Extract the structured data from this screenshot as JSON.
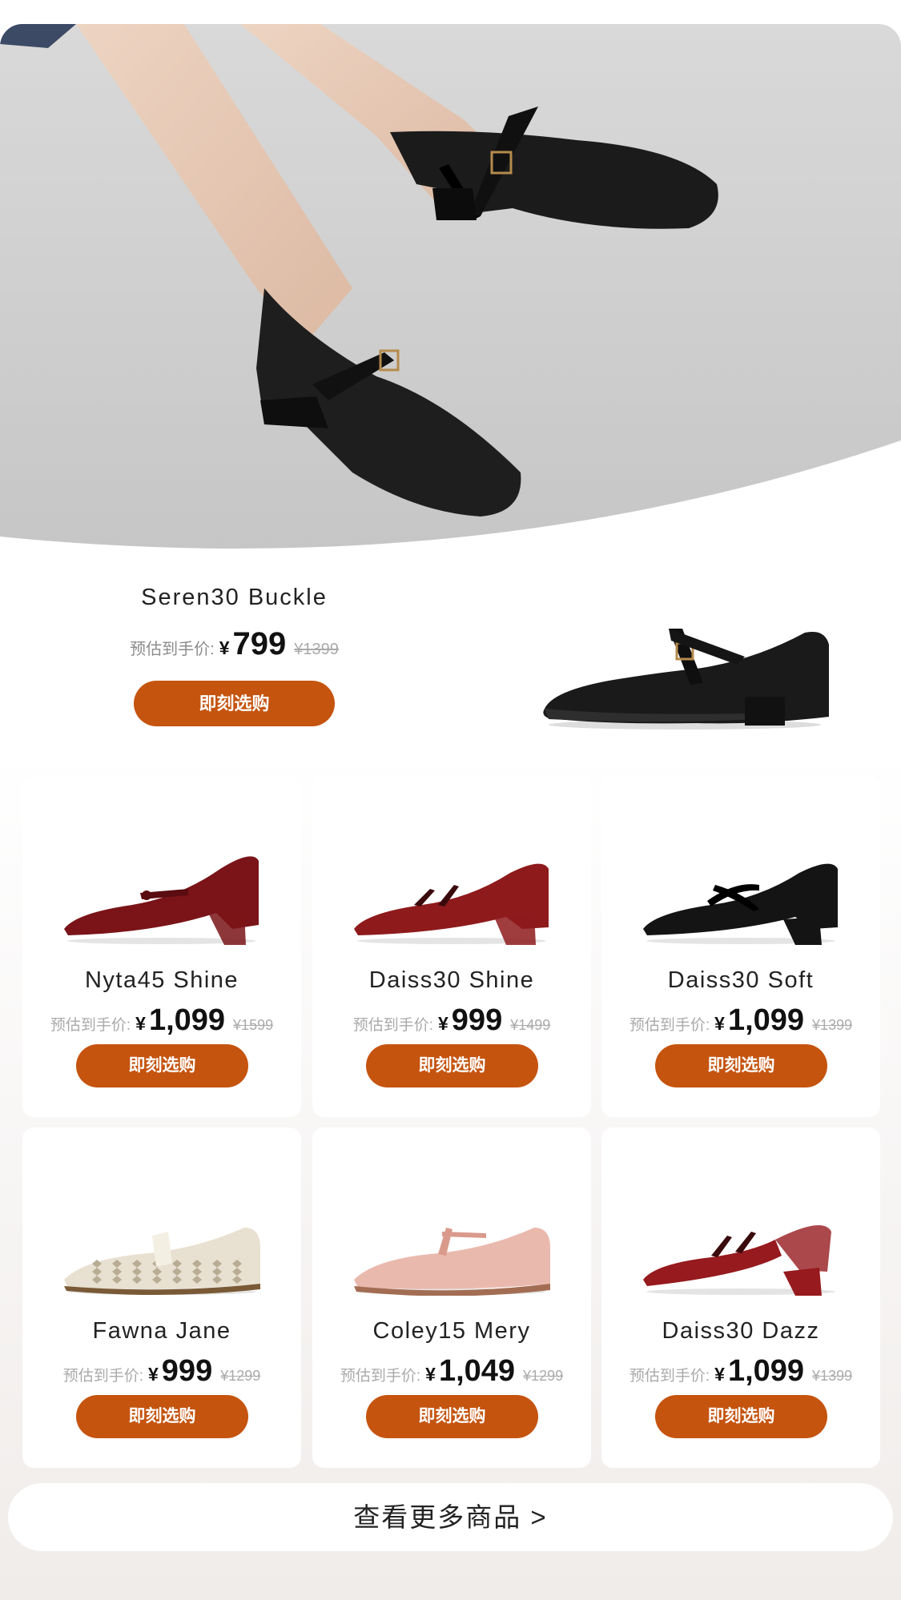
{
  "featured": {
    "name": "Seren30 Buckle",
    "est_label": "预估到手价:",
    "currency": "¥",
    "price": "799",
    "original_price": "¥1399",
    "button_label": "即刻选购"
  },
  "products": [
    {
      "name": "Nyta45 Shine",
      "est_label": "预估到手价:",
      "currency": "¥",
      "price": "1,099",
      "original_price": "¥1599",
      "button_label": "即刻选购",
      "shoe_color": "#7a1418",
      "style": "heel-bow"
    },
    {
      "name": "Daiss30 Shine",
      "est_label": "预估到手价:",
      "currency": "¥",
      "price": "999",
      "original_price": "¥1499",
      "button_label": "即刻选购",
      "shoe_color": "#8e1a1c",
      "style": "double-strap"
    },
    {
      "name": "Daiss30 Soft",
      "est_label": "预估到手价:",
      "currency": "¥",
      "price": "1,099",
      "original_price": "¥1399",
      "button_label": "即刻选购",
      "shoe_color": "#141414",
      "style": "cross-strap"
    },
    {
      "name": "Fawna Jane",
      "est_label": "预估到手价:",
      "currency": "¥",
      "price": "999",
      "original_price": "¥1299",
      "button_label": "即刻选购",
      "shoe_color": "#e8e0d0",
      "style": "woven-flat"
    },
    {
      "name": "Coley15 Mery",
      "est_label": "预估到手价:",
      "currency": "¥",
      "price": "1,049",
      "original_price": "¥1299",
      "button_label": "即刻选购",
      "shoe_color": "#eab9ae",
      "style": "flat"
    },
    {
      "name": "Daiss30 Dazz",
      "est_label": "预估到手价:",
      "currency": "¥",
      "price": "1,099",
      "original_price": "¥1399",
      "button_label": "即刻选购",
      "shoe_color": "#961a1e",
      "style": "slingback"
    }
  ],
  "more_button": "查看更多商品 >",
  "colors": {
    "accent": "#c5540f",
    "price": "#111111",
    "muted": "#aaaaaa"
  }
}
